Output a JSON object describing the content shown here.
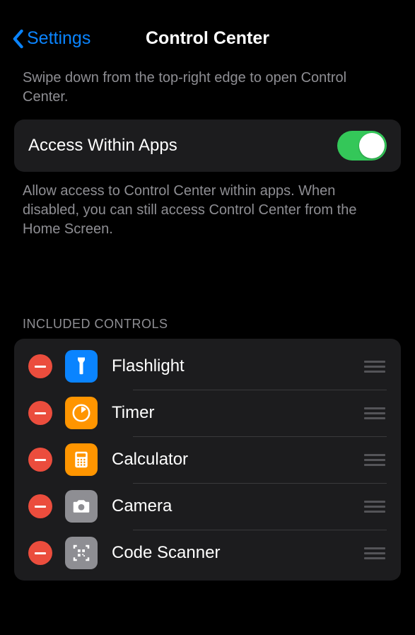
{
  "nav": {
    "back": "Settings",
    "title": "Control Center"
  },
  "hint": "Swipe down from the top-right edge to open Control Center.",
  "access": {
    "label": "Access Within Apps",
    "enabled": true,
    "footer": "Allow access to Control Center within apps. When disabled, you can still access Control Center from the Home Screen."
  },
  "included": {
    "header": "INCLUDED CONTROLS",
    "items": [
      {
        "label": "Flashlight",
        "icon": "flashlight-icon",
        "bg": "#0a84ff"
      },
      {
        "label": "Timer",
        "icon": "timer-icon",
        "bg": "#ff9500"
      },
      {
        "label": "Calculator",
        "icon": "calculator-icon",
        "bg": "#ff9500"
      },
      {
        "label": "Camera",
        "icon": "camera-icon",
        "bg": "#8e8e93"
      },
      {
        "label": "Code Scanner",
        "icon": "code-scanner-icon",
        "bg": "#8e8e93"
      }
    ]
  }
}
